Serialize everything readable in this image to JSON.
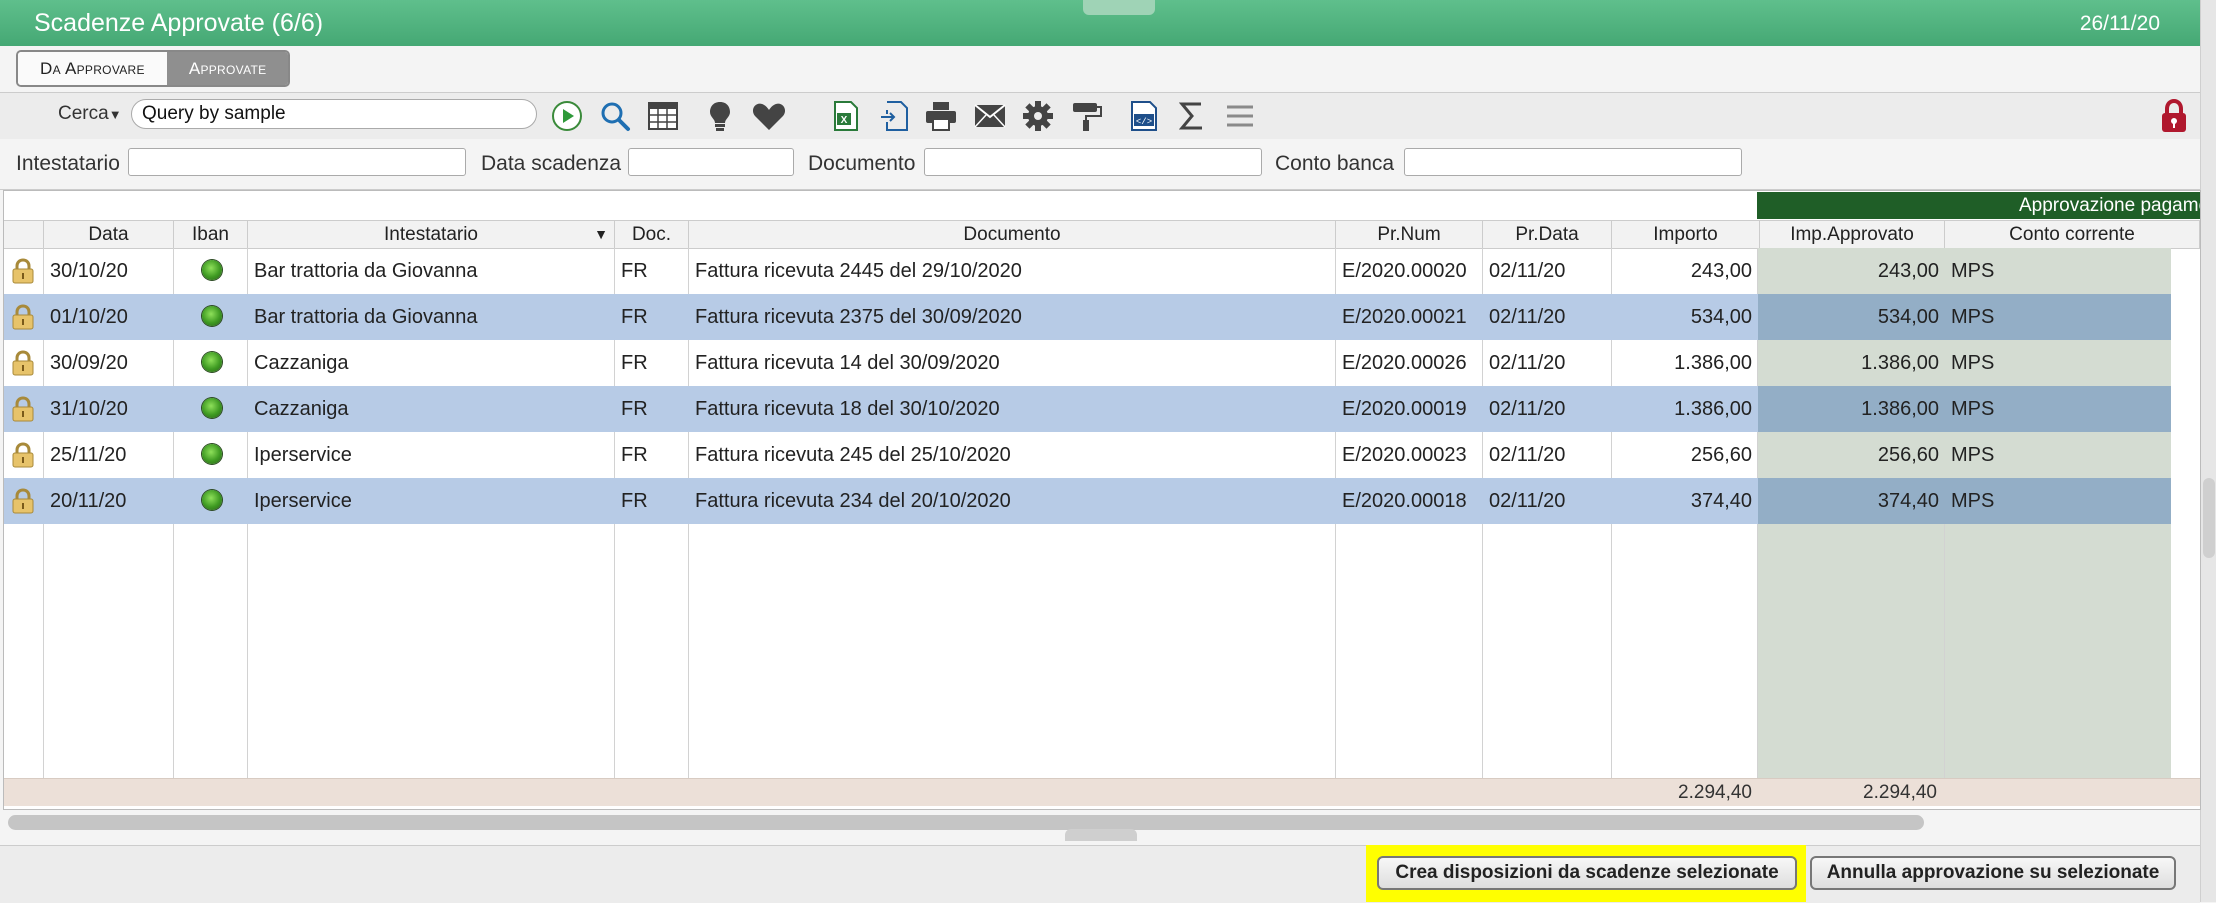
{
  "window": {
    "title": "Scadenze Approvate (6/6)",
    "date": "26/11/20"
  },
  "tabs": [
    {
      "label": "Da Approvare",
      "active": false
    },
    {
      "label": "Approvate",
      "active": true
    }
  ],
  "toolbar": {
    "search_mode": "Cerca",
    "search_value": "Query by sample",
    "icons": [
      "play-icon",
      "search-icon",
      "table-icon",
      "lightbulb-icon",
      "heart-icon",
      "excel-export-icon",
      "import-icon",
      "print-icon",
      "mail-icon",
      "gear-icon",
      "paint-roller-icon",
      "code-icon",
      "sum-icon",
      "menu-icon",
      "lock-icon"
    ]
  },
  "filters": {
    "intestatario": "Intestatario",
    "data_scadenza": "Data scadenza",
    "documento": "Documento",
    "conto_banca": "Conto banca"
  },
  "grid": {
    "group_header": "Approvazione pagamenti",
    "columns": {
      "data": "Data",
      "iban": "Iban",
      "intestatario": "Intestatario",
      "doc": "Doc.",
      "documento": "Documento",
      "prnum": "Pr.Num",
      "prdata": "Pr.Data",
      "importo": "Importo",
      "imp_approvato": "Imp.Approvato",
      "conto": "Conto corrente"
    },
    "rows": [
      {
        "data": "30/10/20",
        "intestatario": "Bar trattoria da Giovanna",
        "doc": "FR",
        "documento": "Fattura ricevuta 2445 del 29/10/2020",
        "prnum": "E/2020.00020",
        "prdata": "02/11/20",
        "importo": "243,00",
        "imp_approvato": "243,00",
        "conto": "MPS"
      },
      {
        "data": "01/10/20",
        "intestatario": "Bar trattoria da Giovanna",
        "doc": "FR",
        "documento": "Fattura ricevuta 2375 del 30/09/2020",
        "prnum": "E/2020.00021",
        "prdata": "02/11/20",
        "importo": "534,00",
        "imp_approvato": "534,00",
        "conto": "MPS"
      },
      {
        "data": "30/09/20",
        "intestatario": "Cazzaniga",
        "doc": "FR",
        "documento": "Fattura ricevuta 14 del 30/09/2020",
        "prnum": "E/2020.00026",
        "prdata": "02/11/20",
        "importo": "1.386,00",
        "imp_approvato": "1.386,00",
        "conto": "MPS"
      },
      {
        "data": "31/10/20",
        "intestatario": "Cazzaniga",
        "doc": "FR",
        "documento": "Fattura ricevuta 18 del 30/10/2020",
        "prnum": "E/2020.00019",
        "prdata": "02/11/20",
        "importo": "1.386,00",
        "imp_approvato": "1.386,00",
        "conto": "MPS"
      },
      {
        "data": "25/11/20",
        "intestatario": "Iperservice",
        "doc": "FR",
        "documento": "Fattura ricevuta 245 del 25/10/2020",
        "prnum": "E/2020.00023",
        "prdata": "02/11/20",
        "importo": "256,60",
        "imp_approvato": "256,60",
        "conto": "MPS"
      },
      {
        "data": "20/11/20",
        "intestatario": "Iperservice",
        "doc": "FR",
        "documento": "Fattura ricevuta 234 del 20/10/2020",
        "prnum": "E/2020.00018",
        "prdata": "02/11/20",
        "importo": "374,40",
        "imp_approvato": "374,40",
        "conto": "MPS"
      }
    ],
    "totals": {
      "importo": "2.294,40",
      "imp_approvato": "2.294,40"
    }
  },
  "footer": {
    "create_button": "Crea disposizioni da scadenze selezionate",
    "cancel_button": "Annulla approvazione su selezionate"
  },
  "colors": {
    "title_bar": "#45a874",
    "group_header": "#1f5e27",
    "selected_row": "#b7cbe6",
    "highlight": "#ffff00",
    "lock_red": "#b0182e"
  }
}
